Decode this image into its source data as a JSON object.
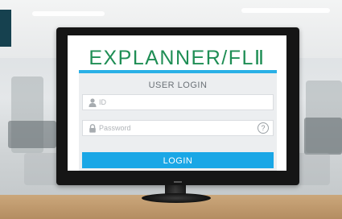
{
  "app": {
    "logo_text": "EXPLANNER/FLⅡ"
  },
  "login": {
    "title": "USER LOGIN",
    "id_placeholder": "ID",
    "password_placeholder": "Password",
    "button_label": "LOGIN",
    "help_icon_glyph": "?"
  },
  "icons": {
    "id_field": "user-icon",
    "password_field": "lock-icon",
    "help": "question-circle-icon"
  },
  "colors": {
    "brand_green": "#1f8e55",
    "accent_blue": "#2ab0e6",
    "button_blue": "#1aa7e6"
  }
}
